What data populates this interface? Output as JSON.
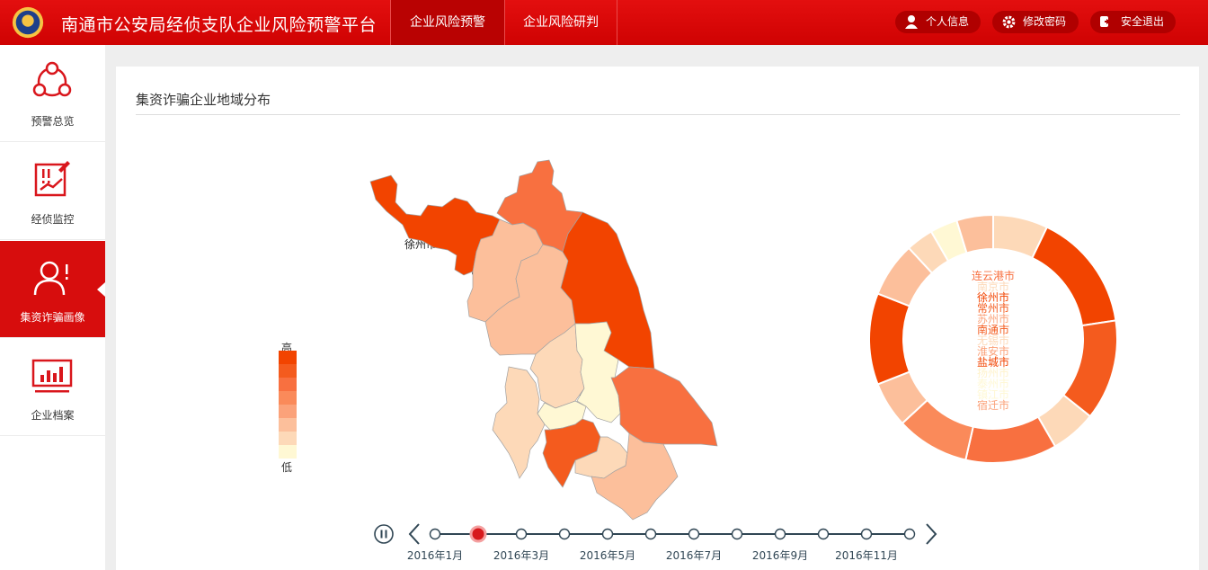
{
  "header": {
    "title": "南通市公安局经侦支队企业风险预警平台",
    "nav": [
      "企业风险预警",
      "企业风险研判"
    ],
    "actions": [
      "个人信息",
      "修改密码",
      "安全退出"
    ]
  },
  "sidebar": {
    "items": [
      {
        "label": "预警总览",
        "icon": "share-nodes-icon",
        "active": false
      },
      {
        "label": "经侦监控",
        "icon": "warning-document-icon",
        "active": false
      },
      {
        "label": "集资诈骗画像",
        "icon": "user-alert-icon",
        "active": true
      },
      {
        "label": "企业档案",
        "icon": "bar-chart-monitor-icon",
        "active": false
      }
    ]
  },
  "panel": {
    "title": "集资诈骗企业地域分布"
  },
  "chart_data": {
    "type": "map",
    "legend": {
      "high": "高",
      "low": "低"
    },
    "colors": [
      "#f24400",
      "#f45b1e",
      "#f87040",
      "#fa8a5a",
      "#fba27a",
      "#fcbf9b",
      "#fdd9b8",
      "#fff8d4"
    ],
    "regions": [
      {
        "name": "徐州市",
        "level": 1
      },
      {
        "name": "连云港市",
        "level": 3
      },
      {
        "name": "宿迁市",
        "level": 6
      },
      {
        "name": "淮安市",
        "level": 6
      },
      {
        "name": "盐城市",
        "level": 1
      },
      {
        "name": "扬州市",
        "level": 7
      },
      {
        "name": "泰州市",
        "level": 8
      },
      {
        "name": "南京市",
        "level": 7
      },
      {
        "name": "镇江市",
        "level": 8
      },
      {
        "name": "常州市",
        "level": 2
      },
      {
        "name": "无锡市",
        "level": 7
      },
      {
        "name": "南通市",
        "level": 3
      },
      {
        "name": "苏州市",
        "level": 6
      }
    ],
    "donut_labels": [
      "连云港市",
      "南京市",
      "徐州市",
      "常州市",
      "苏州市",
      "南通市",
      "无锡市",
      "淮安市",
      "盐城市",
      "扬州市",
      "泰州市",
      "镇江市",
      "宿迁市"
    ],
    "donut_label_colors": [
      "#f87040",
      "#fdd9b8",
      "#f24400",
      "#f45b1e",
      "#fba27a",
      "#f45b1e",
      "#fdd9b8",
      "#fba27a",
      "#f24400",
      "#fff3cc",
      "#fff8d4",
      "#fff8d4",
      "#fba27a"
    ],
    "donut_segments": [
      {
        "level": 7,
        "value": 6
      },
      {
        "level": 1,
        "value": 13
      },
      {
        "level": 2,
        "value": 11
      },
      {
        "level": 7,
        "value": 5
      },
      {
        "level": 3,
        "value": 10
      },
      {
        "level": 4,
        "value": 8
      },
      {
        "level": 6,
        "value": 5
      },
      {
        "level": 1,
        "value": 10
      },
      {
        "level": 6,
        "value": 6
      },
      {
        "level": 7,
        "value": 3
      },
      {
        "level": 8,
        "value": 3
      },
      {
        "level": 6,
        "value": 4
      }
    ],
    "timeline": {
      "labels": [
        "2016年1月",
        "2016年3月",
        "2016年5月",
        "2016年7月",
        "2016年9月",
        "2016年11月"
      ],
      "points": 12,
      "current_index": 1
    }
  }
}
